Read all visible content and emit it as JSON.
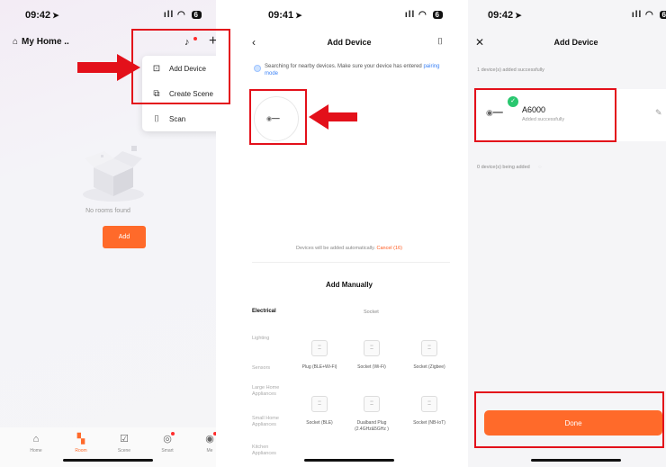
{
  "screen1": {
    "time": "09:42",
    "home_title": "My Home ..",
    "menu": [
      {
        "label": "Add Device",
        "icon": "add-device-icon"
      },
      {
        "label": "Create Scene",
        "icon": "create-scene-icon"
      },
      {
        "label": "Scan",
        "icon": "scan-icon"
      }
    ],
    "empty_text": "No rooms found",
    "add_button": "Add",
    "tabs": [
      {
        "label": "Home",
        "icon": "home-icon"
      },
      {
        "label": "Room",
        "icon": "room-icon"
      },
      {
        "label": "Scene",
        "icon": "scene-icon"
      },
      {
        "label": "Smart",
        "icon": "smart-icon"
      },
      {
        "label": "Me",
        "icon": "me-icon"
      }
    ]
  },
  "screen2": {
    "time": "09:41",
    "title": "Add Device",
    "searching_text": "Searching for nearby devices. Make sure your device has entered",
    "pairing_link": "pairing mode",
    "auto_text": "Devices will be added automatically.",
    "cancel_text": "Cancel (16)",
    "add_manually": "Add Manually",
    "categories": [
      "Electrical",
      "Lighting",
      "Sensors",
      "Large Home Appliances",
      "Small Home Appliances",
      "Kitchen Appliances"
    ],
    "subcategory": "Socket",
    "devices": [
      {
        "name": "Plug (BLE+Wi-Fi)"
      },
      {
        "name": "Socket (Wi-Fi)"
      },
      {
        "name": "Socket (Zigbee)"
      },
      {
        "name": "Socket (BLE)"
      },
      {
        "name": "Dualband Plug (2.4GHz&5GHz )"
      },
      {
        "name": "Socket (NB-IoT)"
      }
    ]
  },
  "screen3": {
    "time": "09:42",
    "title": "Add Device",
    "success_count": "1 device(s) added successfully",
    "device_name": "A6000",
    "device_status": "Added successfully",
    "adding_count": "0 device(s) being added",
    "done_button": "Done"
  },
  "colors": {
    "accent": "#ff6a2a",
    "highlight": "#e3101a",
    "success": "#29c76f",
    "link": "#3b82f6"
  }
}
